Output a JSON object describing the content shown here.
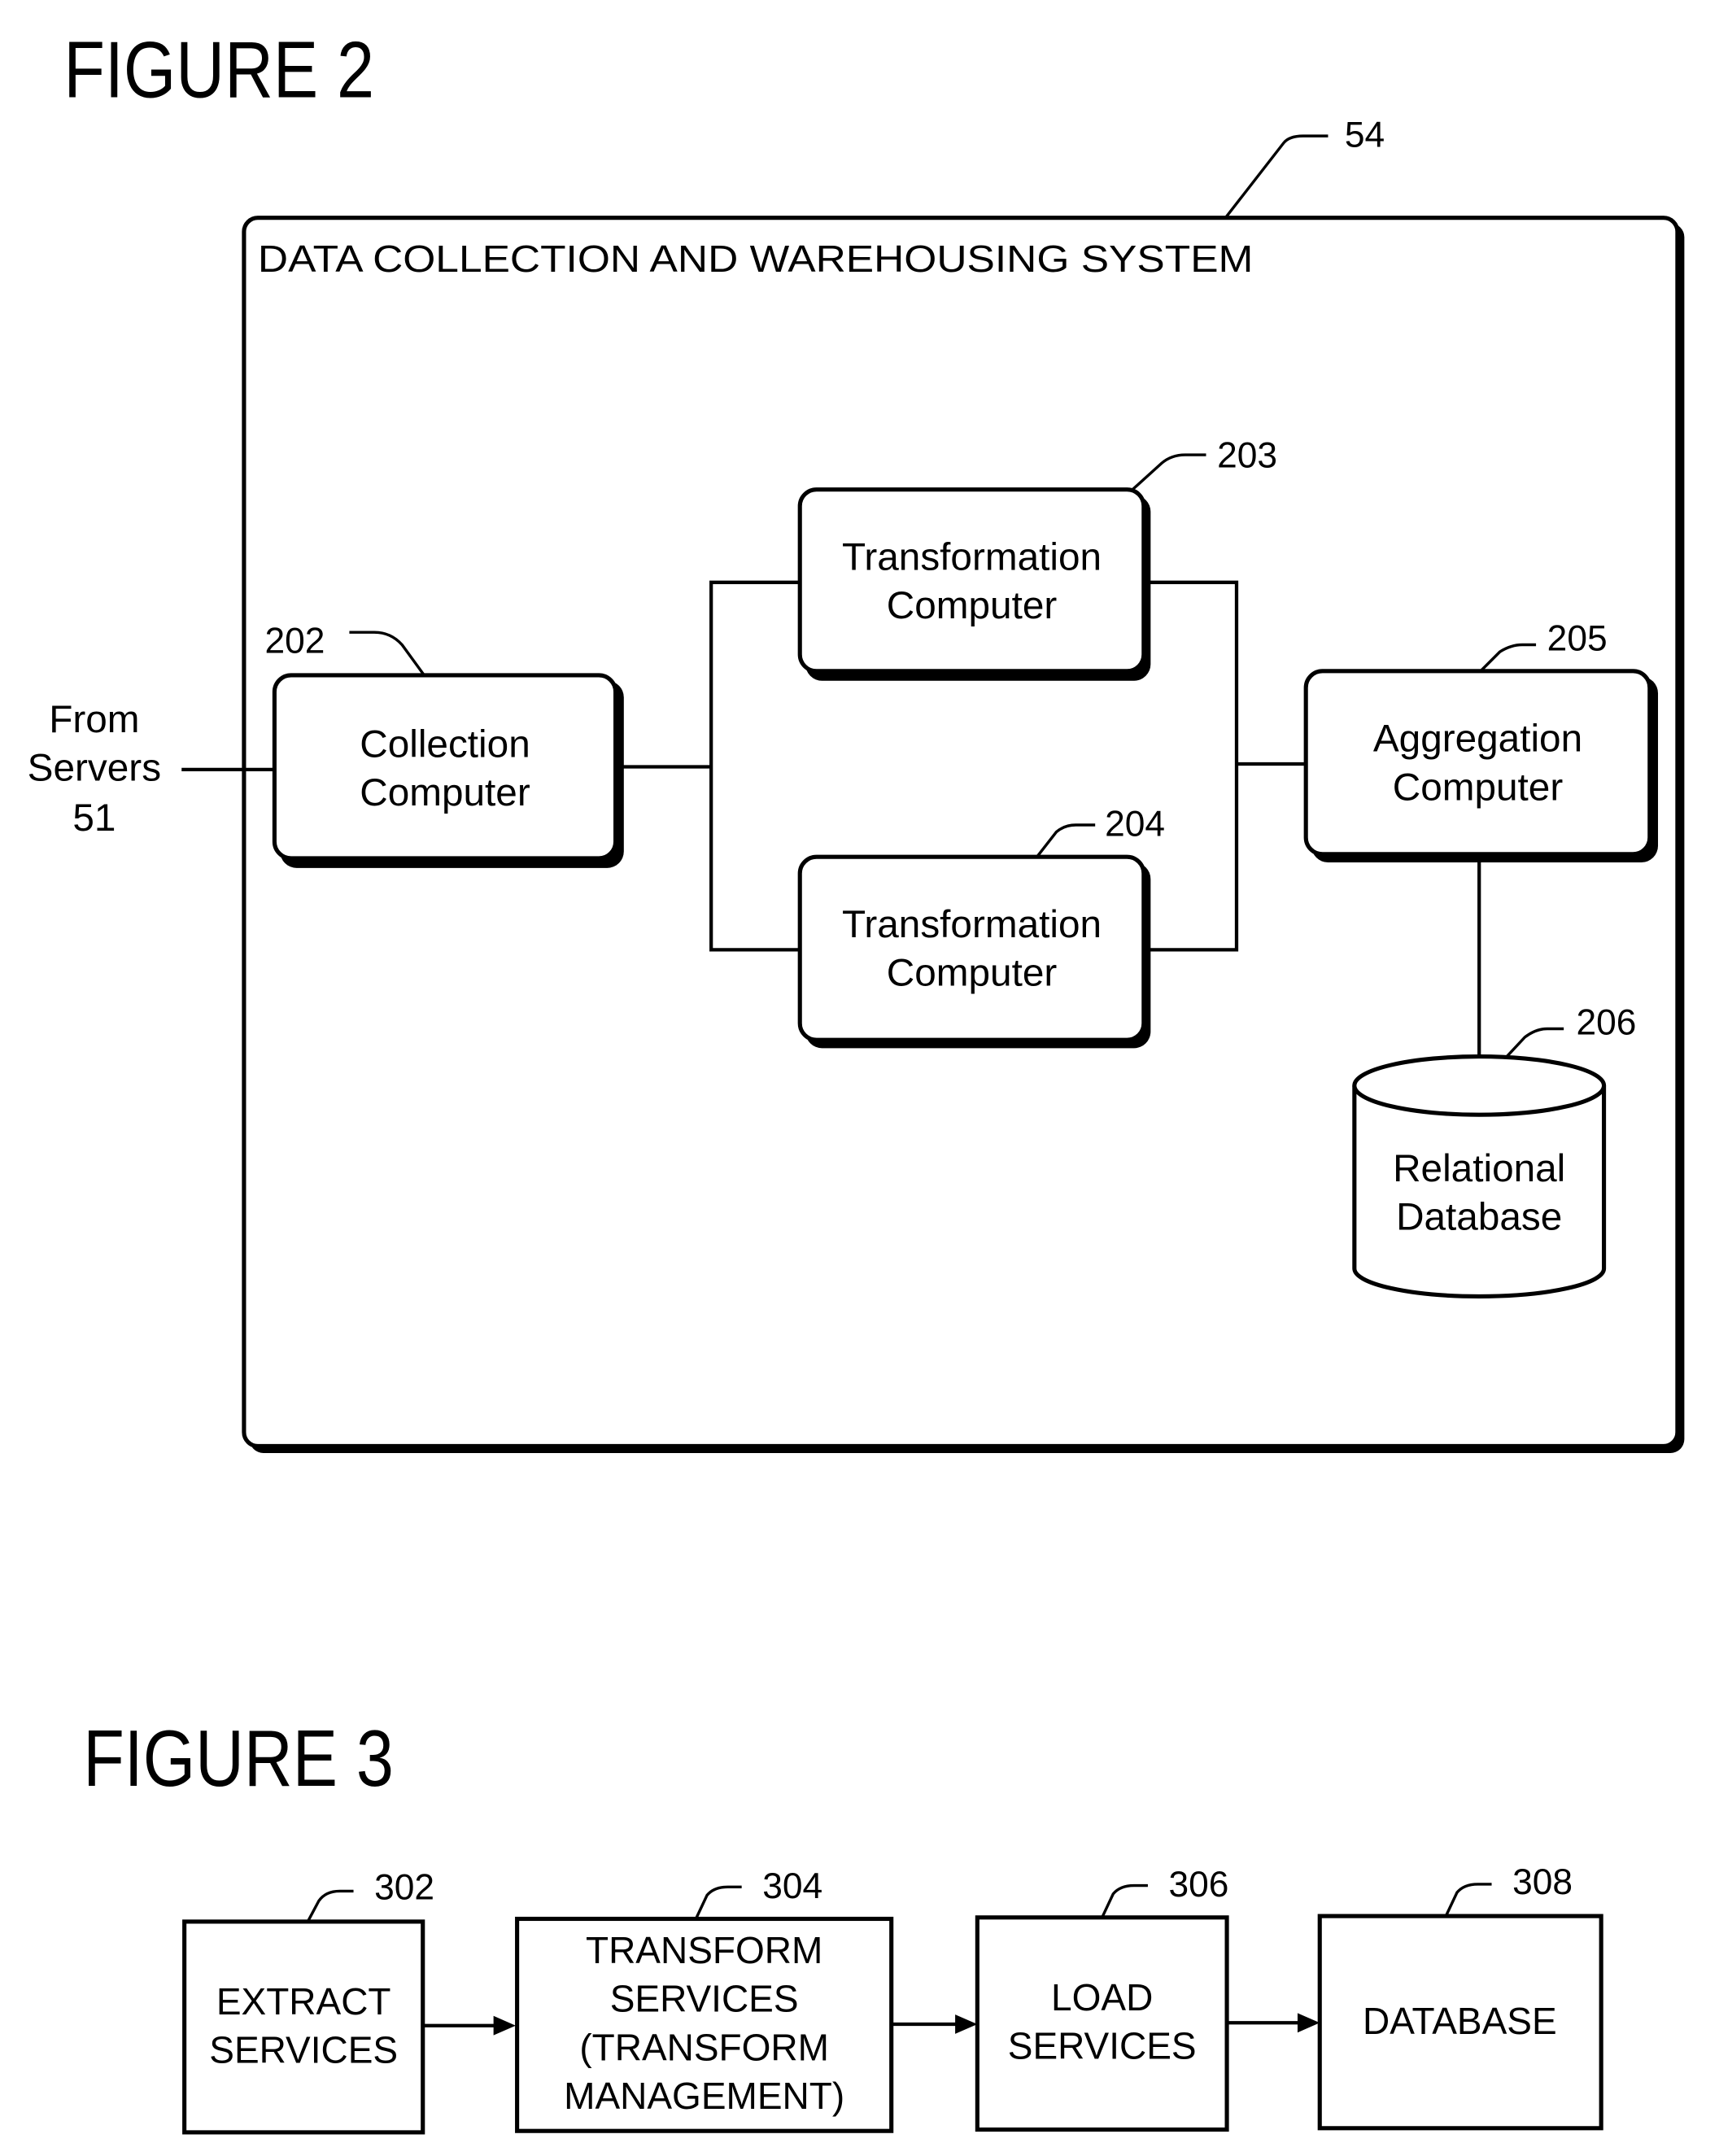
{
  "figure2": {
    "title": "FIGURE 2",
    "system": {
      "ref": "54",
      "label": "DATA COLLECTION AND WAREHOUSING SYSTEM"
    },
    "source": {
      "lines": [
        "From",
        "Servers",
        "51"
      ]
    },
    "nodes": [
      {
        "id": "collection",
        "ref": "202",
        "lines": [
          "Collection",
          "Computer"
        ]
      },
      {
        "id": "transform1",
        "ref": "203",
        "lines": [
          "Transformation",
          "Computer"
        ]
      },
      {
        "id": "transform2",
        "ref": "204",
        "lines": [
          "Transformation",
          "Computer"
        ]
      },
      {
        "id": "aggregation",
        "ref": "205",
        "lines": [
          "Aggregation",
          "Computer"
        ]
      },
      {
        "id": "database",
        "ref": "206",
        "lines": [
          "Relational",
          "Database"
        ],
        "shape": "cylinder"
      }
    ],
    "edges": [
      [
        "source",
        "collection"
      ],
      [
        "collection",
        "transform1"
      ],
      [
        "collection",
        "transform2"
      ],
      [
        "transform1",
        "aggregation"
      ],
      [
        "transform2",
        "aggregation"
      ],
      [
        "aggregation",
        "database"
      ]
    ]
  },
  "figure3": {
    "title": "FIGURE 3",
    "nodes": [
      {
        "id": "extract",
        "ref": "302",
        "lines": [
          "EXTRACT",
          "SERVICES"
        ]
      },
      {
        "id": "transform",
        "ref": "304",
        "lines": [
          "TRANSFORM",
          "SERVICES",
          "(TRANSFORM",
          "MANAGEMENT)"
        ]
      },
      {
        "id": "load",
        "ref": "306",
        "lines": [
          "LOAD",
          "SERVICES"
        ]
      },
      {
        "id": "db",
        "ref": "308",
        "lines": [
          "DATABASE"
        ]
      }
    ],
    "edges": [
      [
        "extract",
        "transform"
      ],
      [
        "transform",
        "load"
      ],
      [
        "load",
        "db"
      ]
    ]
  }
}
